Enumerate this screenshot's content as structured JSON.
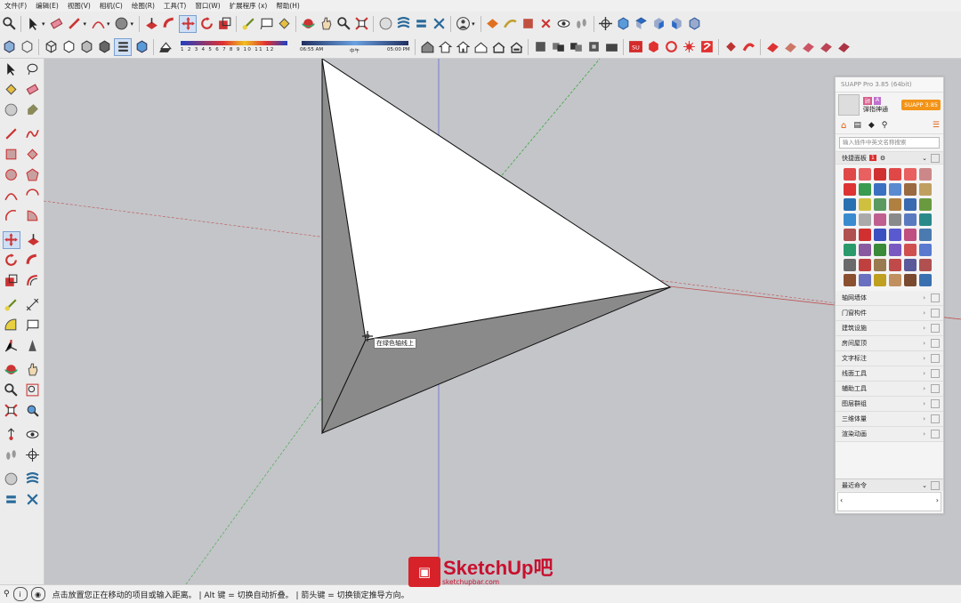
{
  "menu": [
    "文件(F)",
    "编辑(E)",
    "视图(V)",
    "相机(C)",
    "绘图(R)",
    "工具(T)",
    "窗口(W)",
    "扩展程序 (x)",
    "帮助(H)"
  ],
  "toolbar": {
    "shadow_scale": "1 2 3 4 5 6 7 8 9 10 11 12",
    "time_start": "06:55 AM",
    "time_mid": "中午",
    "time_end": "05:00 PM"
  },
  "viewport": {
    "tooltip": "在绿色轴线上",
    "colors": {
      "face_white": "#ffffff",
      "face_gray": "#8d8d8d",
      "red_axis": "#c05050",
      "green_axis": "#3aa83a",
      "blue_axis": "#6a6ad0"
    }
  },
  "suapp": {
    "title": "SUAPP Pro 3.85 (64bit)",
    "user_name": "弹指神通",
    "user_badges": [
      "顾",
      "A"
    ],
    "version_badge": "SUAPP 3.85",
    "search_placeholder": "输入插件中英文名称搜索",
    "quick_panel": "快捷面板",
    "quick_badge": "1",
    "categories": [
      "轴网墙体",
      "门窗构件",
      "建筑设施",
      "房间屋顶",
      "文字标注",
      "线面工具",
      "辅助工具",
      "图层群组",
      "三维体量",
      "渲染动画"
    ],
    "recent": "最近命令"
  },
  "status": {
    "text": "点击放置您正在移动的项目或输入距离。 | Alt 键 = 切换自动折叠。 | 箭头键 = 切换锁定推导方向。"
  },
  "watermark": {
    "word": "SketchUp吧",
    "url": "sketchupbar.com"
  }
}
